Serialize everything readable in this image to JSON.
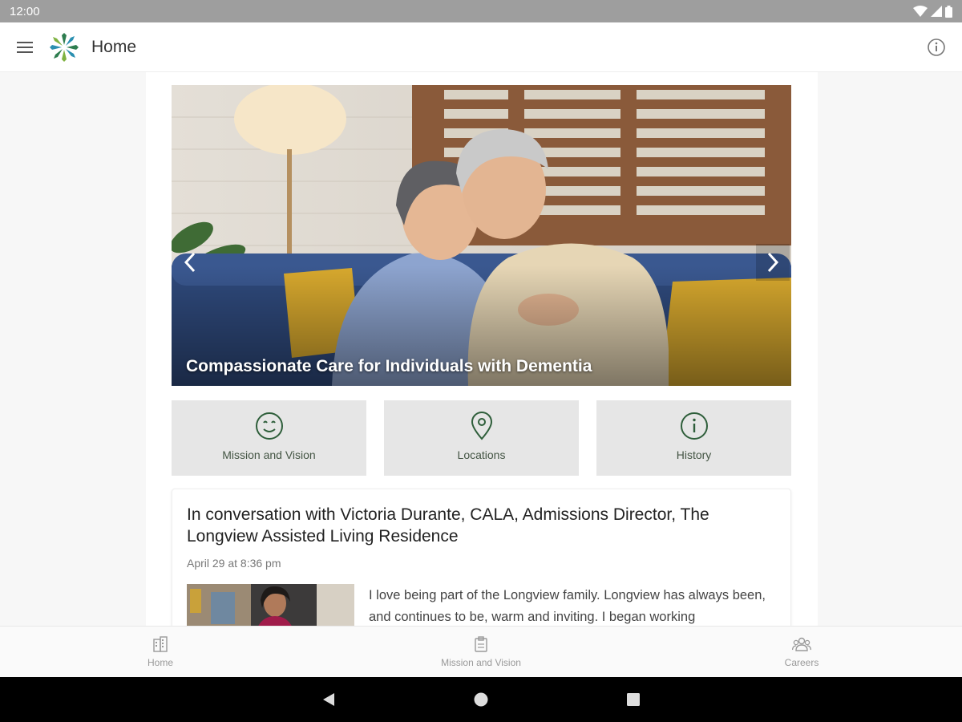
{
  "status_bar": {
    "time": "12:00"
  },
  "app_bar": {
    "title": "Home"
  },
  "hero": {
    "caption": "Compassionate Care for Individuals with Dementia"
  },
  "tiles": [
    {
      "label": "Mission and Vision",
      "icon": "smile-icon"
    },
    {
      "label": "Locations",
      "icon": "location-pin-icon"
    },
    {
      "label": "History",
      "icon": "info-icon"
    }
  ],
  "article": {
    "title": "In conversation with Victoria Durante, CALA, Admissions Director, The Longview Assisted Living Residence",
    "date": "April 29 at 8:36 pm",
    "excerpt": "I love being part of the Longview family. Longview has always been, and continues to be, warm and inviting. I began working"
  },
  "bottom_nav": [
    {
      "label": "Home",
      "icon": "building-icon"
    },
    {
      "label": "Mission and Vision",
      "icon": "clipboard-icon"
    },
    {
      "label": "Careers",
      "icon": "people-icon"
    }
  ],
  "colors": {
    "accent_green": "#2e5e3a",
    "tile_bg": "#e6e6e6",
    "status_bar": "#9e9e9e"
  }
}
